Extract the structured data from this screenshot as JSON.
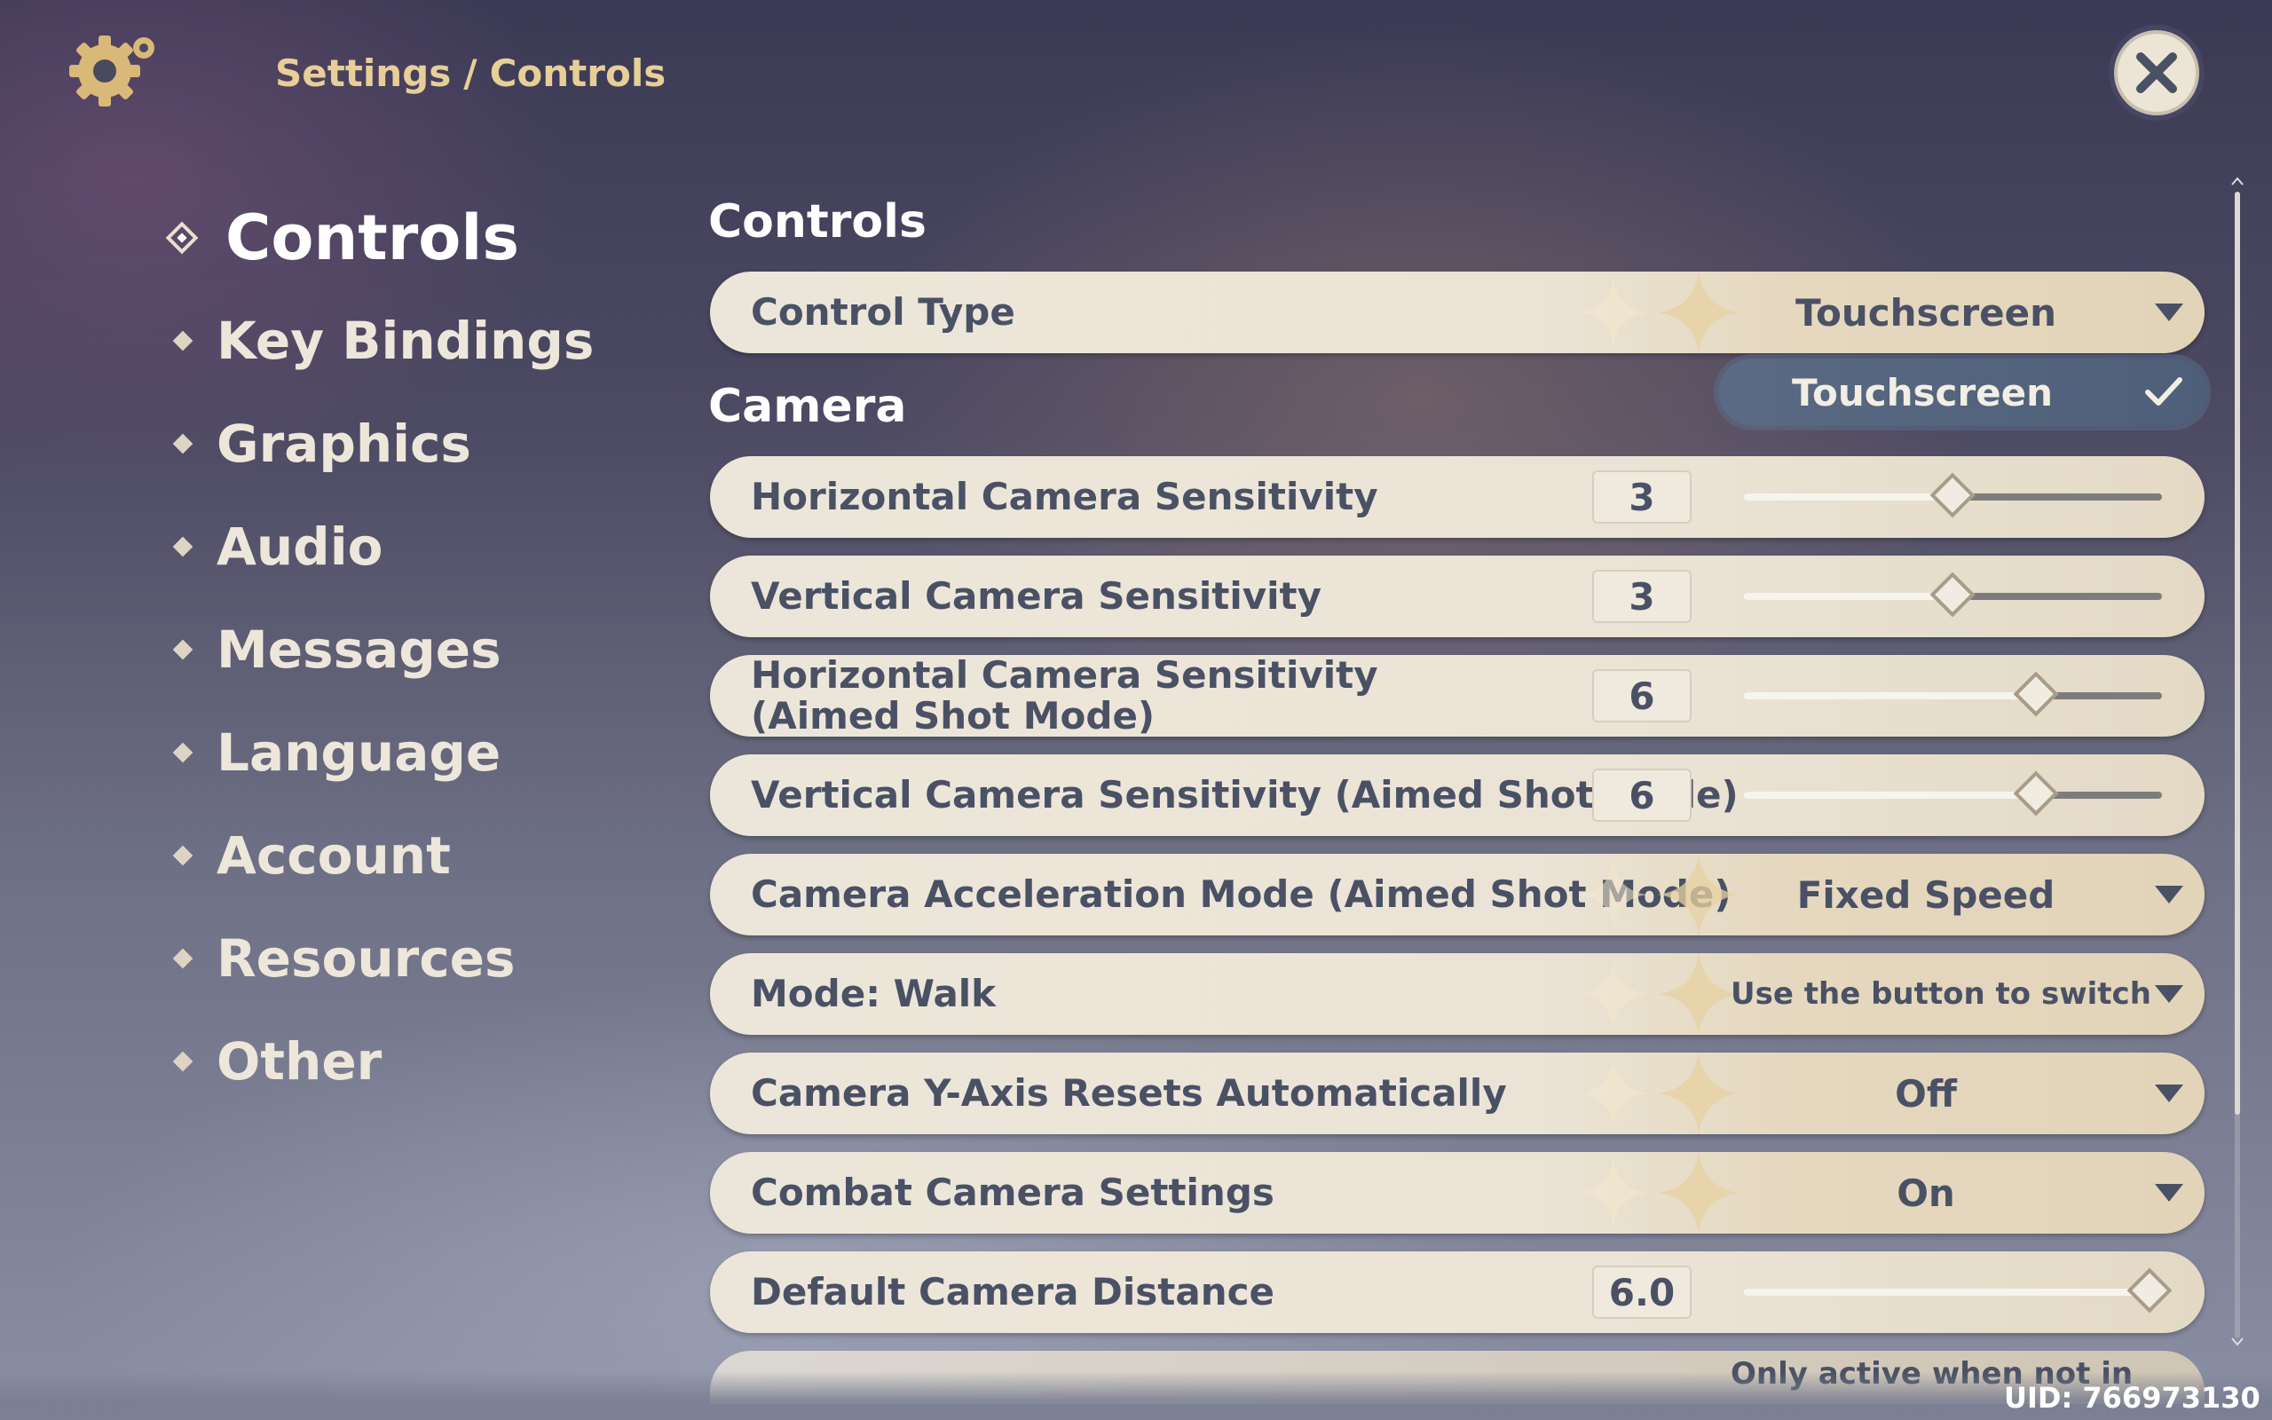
{
  "header": {
    "breadcrumb_parent": "Settings",
    "separator": "/",
    "breadcrumb_current": "Controls"
  },
  "sidebar": {
    "items": [
      {
        "label": "Controls",
        "active": true
      },
      {
        "label": "Key Bindings"
      },
      {
        "label": "Graphics"
      },
      {
        "label": "Audio"
      },
      {
        "label": "Messages"
      },
      {
        "label": "Language"
      },
      {
        "label": "Account"
      },
      {
        "label": "Resources"
      },
      {
        "label": "Other"
      }
    ]
  },
  "sections": {
    "controls_title": "Controls",
    "camera_title": "Camera"
  },
  "settings": {
    "control_type": {
      "label": "Control Type",
      "value": "Touchscreen"
    },
    "control_type_popup": {
      "option": "Touchscreen",
      "selected": true
    },
    "h_sens": {
      "label": "Horizontal Camera Sensitivity",
      "value": "3",
      "fraction": 0.5
    },
    "v_sens": {
      "label": "Vertical Camera Sensitivity",
      "value": "3",
      "fraction": 0.5
    },
    "h_sens_aim": {
      "label": "Horizontal Camera Sensitivity (Aimed Shot Mode)",
      "value": "6",
      "fraction": 0.7
    },
    "v_sens_aim": {
      "label": "Vertical Camera Sensitivity (Aimed Shot Mode)",
      "value": "6",
      "fraction": 0.7
    },
    "accel_mode": {
      "label": "Camera Acceleration Mode (Aimed Shot Mode)",
      "value": "Fixed Speed"
    },
    "mode_walk": {
      "label": "Mode: Walk",
      "value": "Use the button to switch"
    },
    "y_reset": {
      "label": "Camera Y-Axis Resets Automatically",
      "value": "Off"
    },
    "combat_cam": {
      "label": "Combat Camera Settings",
      "value": "On"
    },
    "default_dist": {
      "label": "Default Camera Distance",
      "value": "6.0",
      "fraction": 0.97
    },
    "next_partial": {
      "value": "Only active when not in"
    }
  },
  "footer": {
    "uid": "UID: 766973130"
  },
  "colors": {
    "accent_gold": "#e8cf98",
    "row_text": "#4a5165",
    "popup_bg": "#55657e"
  },
  "icons": {
    "header": "gear-icon",
    "close": "close-icon",
    "check": "check-icon",
    "dropdown": "triangle-down-icon"
  }
}
